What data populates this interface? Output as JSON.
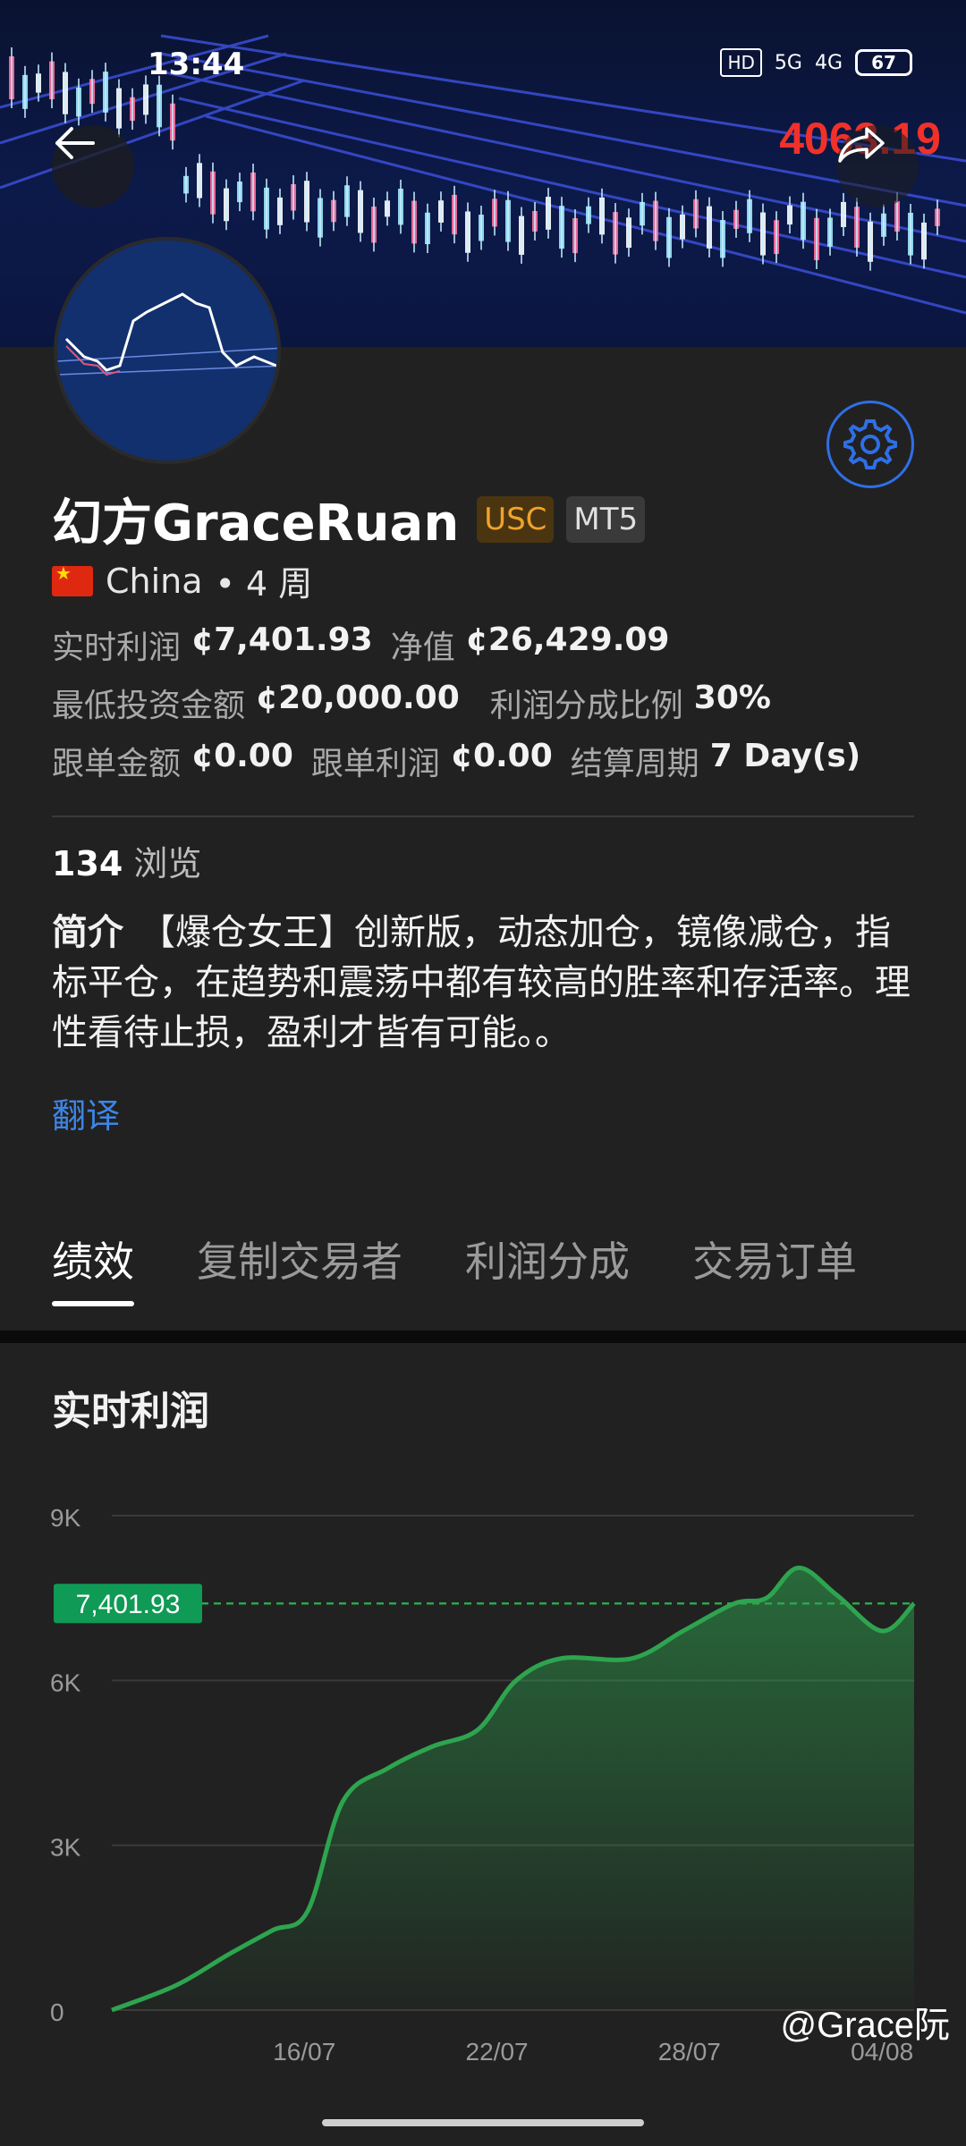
{
  "status": {
    "time": "13:44",
    "hd": "HD",
    "net1": "5G",
    "net2": "4G",
    "battery": "67"
  },
  "banner": {
    "price": "4063.19"
  },
  "profile": {
    "name": "幻方GraceRuan",
    "badge_usc": "USC",
    "badge_mt5": "MT5",
    "country": "China",
    "weeks": "• 4 周",
    "realtime_profit_label": "实时利润",
    "realtime_profit_value": "¢7,401.93",
    "equity_label": "净值",
    "equity_value": "¢26,429.09",
    "min_invest_label": "最低投资金额",
    "min_invest_value": "¢20,000.00",
    "share_ratio_label": "利润分成比例",
    "share_ratio_value": "30%",
    "follow_amount_label": "跟单金额",
    "follow_amount_value": "¢0.00",
    "follow_profit_label": "跟单利润",
    "follow_profit_value": "¢0.00",
    "settle_label": "结算周期",
    "settle_value": "7 Day(s)",
    "views_count": "134",
    "views_label": "浏览",
    "intro_label": "简介",
    "intro_text": "【爆仓女王】创新版，动态加仓，镜像减仓，指标平仓，在趋势和震荡中都有较高的胜率和存活率。理性看待止损，盈利才皆有可能。。",
    "translate": "翻译"
  },
  "tabs": [
    {
      "label": "绩效",
      "active": true
    },
    {
      "label": "复制交易者",
      "active": false
    },
    {
      "label": "利润分成",
      "active": false
    },
    {
      "label": "交易订单",
      "active": false
    }
  ],
  "watermark": "@Grace阮",
  "colors": {
    "accent_green": "#2ea44f",
    "badge_orange": "#f0a32a",
    "link_blue": "#3d86e6",
    "price_red": "#f0312a"
  },
  "chart_data": {
    "type": "area",
    "title": "实时利润",
    "current_label": "7,401.93",
    "current_value": 7401.93,
    "y_ticks": [
      "9K",
      "6K",
      "3K",
      "0"
    ],
    "y_tick_values": [
      9000,
      6000,
      3000,
      0
    ],
    "ylim": [
      0,
      9000
    ],
    "x_ticks": [
      "16/07",
      "22/07",
      "28/07",
      "04/08"
    ],
    "x_tick_index": [
      6,
      12,
      18,
      24
    ],
    "x_index_range": [
      0,
      25
    ],
    "series": [
      {
        "values": [
          0,
          450,
          1000,
          1450,
          1800,
          3800,
          4400,
          4800,
          5100,
          6000,
          6400,
          6400,
          6900,
          7400,
          7500,
          8050,
          7550,
          6900,
          7401.93
        ],
        "x_index": [
          0,
          2,
          3.6,
          5,
          6.1,
          7.2,
          8.6,
          10,
          11.4,
          12.6,
          14,
          16.2,
          17.8,
          19.4,
          20.4,
          21.4,
          22.6,
          24,
          25
        ]
      }
    ]
  }
}
